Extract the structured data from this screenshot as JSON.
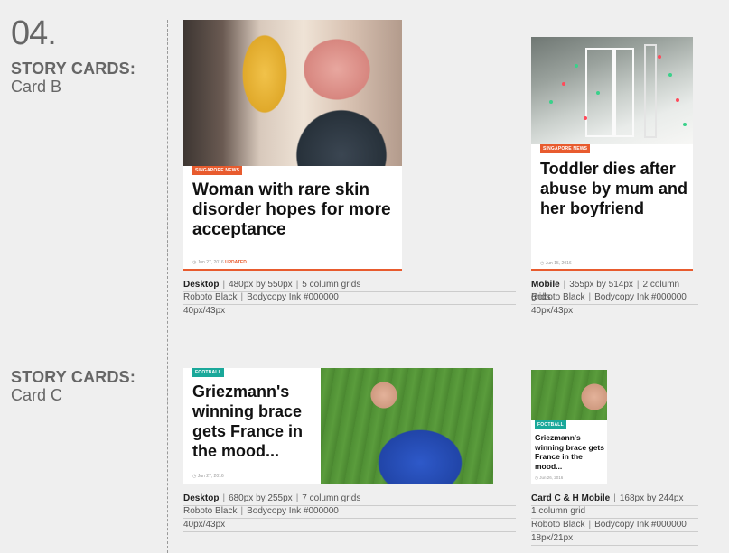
{
  "section_number": "04.",
  "sections": [
    {
      "title": "STORY CARDS:",
      "subtitle": "Card B"
    },
    {
      "title": "STORY CARDS:",
      "subtitle": "Card C"
    }
  ],
  "cards": {
    "b_desktop": {
      "tag": "SINGAPORE NEWS",
      "headline": "Woman with rare skin disorder hopes for more acceptance",
      "date": "Jun 27, 2016",
      "updated": "UPDATED"
    },
    "b_mobile": {
      "tag": "SINGAPORE NEWS",
      "headline": "Toddler dies after abuse by mum and her boyfriend",
      "date": "Jun 15, 2016"
    },
    "c_desktop": {
      "tag": "FOOTBALL",
      "headline": "Griezmann's winning brace gets France in the mood...",
      "date": "Jun 27, 2016"
    },
    "c_mobile": {
      "tag": "FOOTBALL",
      "headline": "Griezmann's winning brace gets France in the mood...",
      "date": "Jun 26, 2016"
    }
  },
  "specs": {
    "b_desktop": {
      "line1_label": "Desktop",
      "line1_size": "480px by 550px",
      "line1_grid": "5 column grids",
      "line2_font": "Roboto Black",
      "line2_ink": "Bodycopy Ink #000000",
      "line3": "40px/43px"
    },
    "b_mobile": {
      "line1_label": "Mobile",
      "line1_size": "355px by 514px",
      "line1_grid": "2 column grids",
      "line2_font": "Roboto Black",
      "line2_ink": "Bodycopy Ink #000000",
      "line3": "40px/43px"
    },
    "c_desktop": {
      "line1_label": "Desktop",
      "line1_size": "680px by 255px",
      "line1_grid": "7 column grids",
      "line2_font": "Roboto Black",
      "line2_ink": "Bodycopy Ink #000000",
      "line3": "40px/43px"
    },
    "c_mobile": {
      "line1_label": "Card C & H Mobile",
      "line1_size": "168px by 244px",
      "line2": "1 column grid",
      "line3_font": "Roboto Black",
      "line3_ink": "Bodycopy Ink #000000",
      "line4": "18px/21px"
    }
  },
  "colors": {
    "accent_orange": "#e85b2e",
    "accent_teal": "#1aa89a"
  }
}
